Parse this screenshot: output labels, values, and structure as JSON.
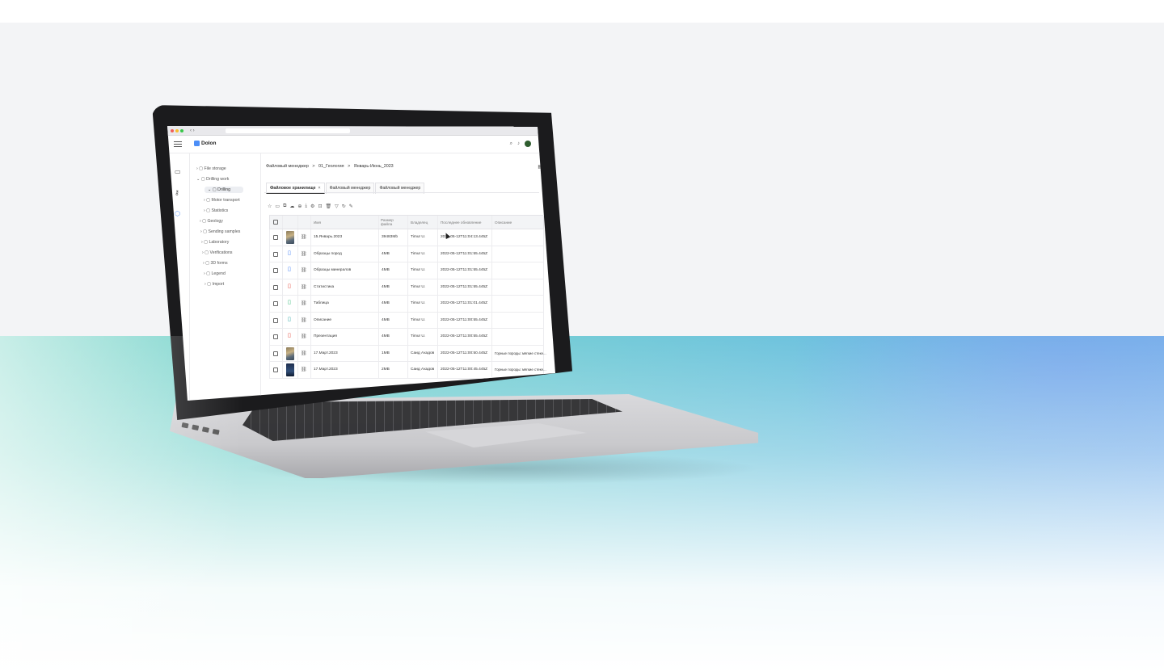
{
  "app": {
    "name": "Dolon"
  },
  "sidebar": {
    "items": [
      {
        "label": "File storage"
      },
      {
        "label": "Drilling work"
      },
      {
        "label": "Drilling"
      },
      {
        "label": "Motor transport"
      },
      {
        "label": "Statistics"
      },
      {
        "label": "Geology"
      },
      {
        "label": "Sending samples"
      },
      {
        "label": "Laboratory"
      },
      {
        "label": "Verifications"
      },
      {
        "label": "3D forms"
      },
      {
        "label": "Legend"
      },
      {
        "label": "Import"
      }
    ]
  },
  "breadcrumbs": [
    "Файловый менеджер",
    ">",
    "01_Геология",
    ">",
    "Январь-Июнь_2023"
  ],
  "tabs": [
    {
      "label": "Файловое хранилище",
      "close": "×"
    },
    {
      "label": "Файловый менеджер"
    },
    {
      "label": "Файловый менеджер"
    }
  ],
  "table": {
    "columns": [
      "Имя",
      "Размер файла",
      "Владелец",
      "Последнее обновление",
      "Описание"
    ],
    "rows": [
      {
        "name": "15.Январь.2023",
        "size": "39483Mb",
        "owner": "Timur U.",
        "updated": "2022-05-12T11:04:13.445Z",
        "desc": "",
        "kind": "image"
      },
      {
        "name": "Образцы пород",
        "size": "4MB",
        "owner": "Timur U.",
        "updated": "2022-05-12T11:01:55.445Z",
        "desc": "",
        "kind": "doc"
      },
      {
        "name": "Образцы минералов",
        "size": "4MB",
        "owner": "Timur U.",
        "updated": "2022-05-12T11:01:55.445Z",
        "desc": "",
        "kind": "doc"
      },
      {
        "name": "Статистика",
        "size": "4MB",
        "owner": "Timur U.",
        "updated": "2022-05-12T11:01:55.445Z",
        "desc": "",
        "kind": "pdf"
      },
      {
        "name": "Таблица",
        "size": "4MB",
        "owner": "Timur U.",
        "updated": "2022-05-12T11:01:01.445Z",
        "desc": "",
        "kind": "sheet"
      },
      {
        "name": "Описание",
        "size": "4MB",
        "owner": "Timur U.",
        "updated": "2022-05-12T11:00:55.445Z",
        "desc": "",
        "kind": "text"
      },
      {
        "name": "Презентация",
        "size": "4MB",
        "owner": "Timur U.",
        "updated": "2022-05-12T11:00:55.445Z",
        "desc": "",
        "kind": "slides"
      },
      {
        "name": "17.Март.2023",
        "size": "1MB",
        "owner": "Саид Ахадов",
        "updated": "2022-05-12T11:00:50.445Z",
        "desc": "Горные породы: мягкие стеке...",
        "kind": "image"
      },
      {
        "name": "17.Март.2023",
        "size": "2MB",
        "owner": "Саид Ахадов",
        "updated": "2022-05-12T11:00:45.445Z",
        "desc": "Горные породы: мягкие стеке...",
        "kind": "image2"
      }
    ]
  },
  "colors": {
    "accent": "#4c8ef7",
    "pdf": "#e4453a",
    "sheet": "#2bb673",
    "doc": "#3b7cf5"
  },
  "icons": {
    "toolbar": [
      "star-icon",
      "folder-icon",
      "copy-icon",
      "cloud-icon",
      "share-icon",
      "download-icon",
      "gear-icon",
      "view-icon",
      "trash-icon",
      "filter-icon",
      "refresh-icon",
      "edit-icon"
    ]
  }
}
